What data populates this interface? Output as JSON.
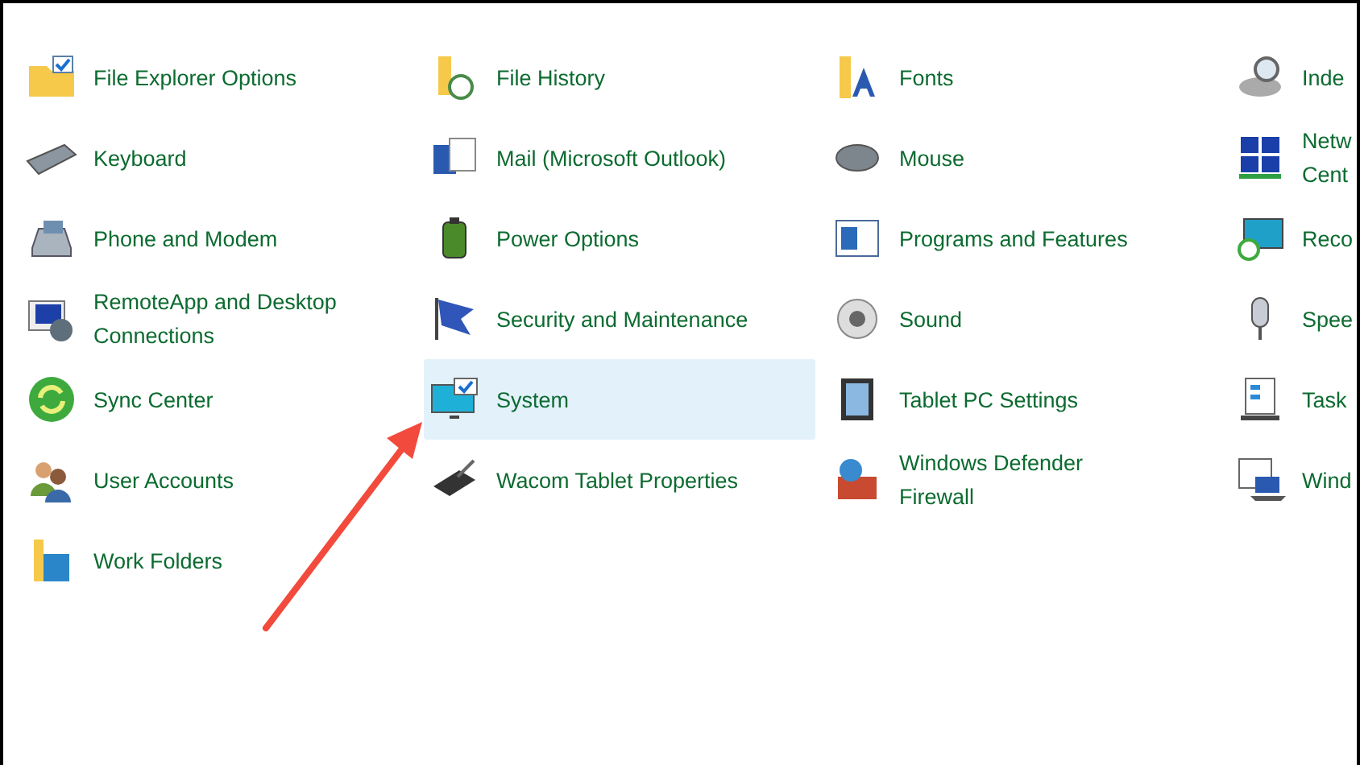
{
  "columns": [
    [
      {
        "label": "File Explorer Options",
        "selected": false
      },
      {
        "label": "Keyboard",
        "selected": false
      },
      {
        "label": "Phone and Modem",
        "selected": false
      },
      {
        "label": "RemoteApp and Desktop\nConnections",
        "selected": false
      },
      {
        "label": "Sync Center",
        "selected": false
      },
      {
        "label": "User Accounts",
        "selected": false
      },
      {
        "label": "Work Folders",
        "selected": false
      }
    ],
    [
      {
        "label": "File History",
        "selected": false
      },
      {
        "label": "Mail (Microsoft Outlook)",
        "selected": false
      },
      {
        "label": "Power Options",
        "selected": false
      },
      {
        "label": "Security and Maintenance",
        "selected": false
      },
      {
        "label": "System",
        "selected": true
      },
      {
        "label": "Wacom Tablet Properties",
        "selected": false
      }
    ],
    [
      {
        "label": "Fonts",
        "selected": false
      },
      {
        "label": "Mouse",
        "selected": false
      },
      {
        "label": "Programs and Features",
        "selected": false
      },
      {
        "label": "Sound",
        "selected": false
      },
      {
        "label": "Tablet PC Settings",
        "selected": false
      },
      {
        "label": "Windows Defender\nFirewall",
        "selected": false
      }
    ],
    [
      {
        "label": "Inde",
        "selected": false
      },
      {
        "label": "Netw\nCent",
        "selected": false
      },
      {
        "label": "Reco",
        "selected": false
      },
      {
        "label": "Spee",
        "selected": false
      },
      {
        "label": "Task",
        "selected": false
      },
      {
        "label": "Wind",
        "selected": false
      }
    ]
  ]
}
